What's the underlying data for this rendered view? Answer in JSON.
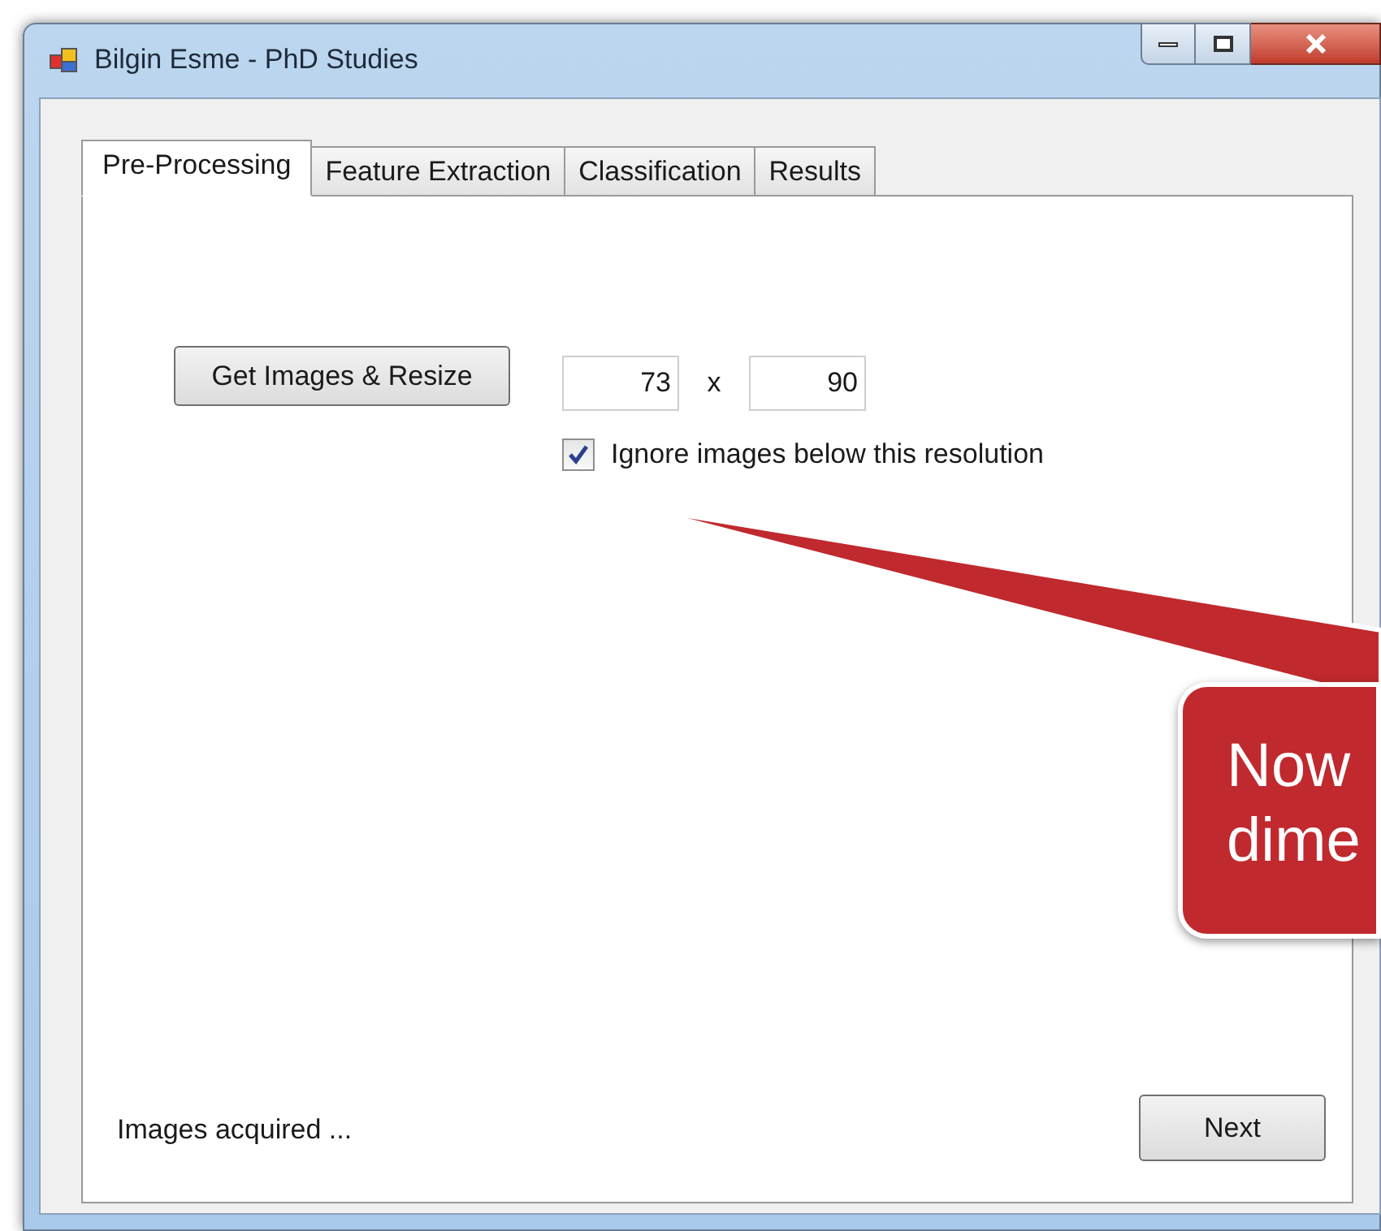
{
  "window": {
    "title": "Bilgin Esme - PhD Studies"
  },
  "tabs": [
    {
      "label": "Pre-Processing",
      "selected": true
    },
    {
      "label": "Feature Extraction",
      "selected": false
    },
    {
      "label": "Classification",
      "selected": false
    },
    {
      "label": "Results",
      "selected": false
    }
  ],
  "get_images_button": "Get Images & Resize",
  "width_field": {
    "value": "73"
  },
  "separator": "x",
  "height_field": {
    "value": "90"
  },
  "ignore_checkbox": {
    "label": "Ignore images below this resolution",
    "checked": true
  },
  "status": "Images acquired ...",
  "next_button": "Next",
  "callout": {
    "lines": [
      "Now",
      "dime"
    ]
  }
}
